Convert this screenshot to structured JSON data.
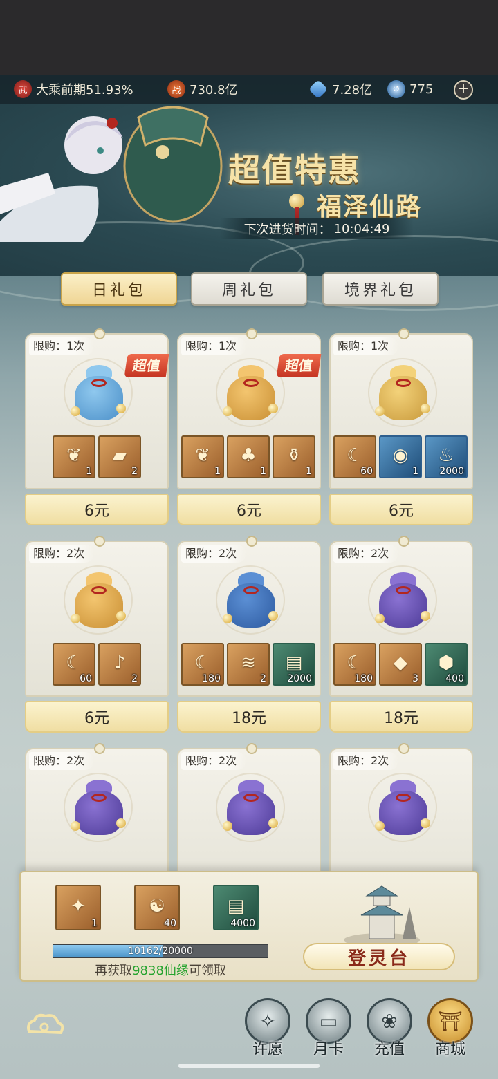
{
  "resources": {
    "realm": "大乘前期51.93%",
    "realm_icon": "武",
    "power": "730.8亿",
    "power_icon": "战",
    "spirit_stones": "7.28亿",
    "jade": "775",
    "plus": "+"
  },
  "banner": {
    "title": "超值特惠",
    "subtitle": "福泽仙路",
    "restock_label": "下次进货时间：",
    "restock_time": "10:04:49"
  },
  "tabs": [
    {
      "label": "日礼包",
      "active": true
    },
    {
      "label": "周礼包",
      "active": false
    },
    {
      "label": "境界礼包",
      "active": false
    }
  ],
  "packs": [
    {
      "limit": "限购：1次",
      "badge": "超值",
      "price": "6元",
      "items": [
        {
          "icon": "gift-bag-icon",
          "qty": "1"
        },
        {
          "icon": "card-icon",
          "qty": "2"
        }
      ]
    },
    {
      "limit": "限购：1次",
      "badge": "超值",
      "price": "6元",
      "items": [
        {
          "icon": "gift-bag-icon",
          "qty": "1"
        },
        {
          "icon": "gourd-icon",
          "qty": "1"
        },
        {
          "icon": "potion-icon",
          "qty": "1"
        }
      ]
    },
    {
      "limit": "限购：1次",
      "badge": "",
      "price": "6元",
      "items": [
        {
          "icon": "crescent-icon",
          "qty": "60"
        },
        {
          "icon": "orb-icon",
          "qty": "1"
        },
        {
          "icon": "flame-icon",
          "qty": "2000"
        }
      ]
    },
    {
      "limit": "限购：2次",
      "badge": "",
      "price": "6元",
      "items": [
        {
          "icon": "crescent-icon",
          "qty": "60"
        },
        {
          "icon": "bell-icon",
          "qty": "2"
        }
      ]
    },
    {
      "limit": "限购：2次",
      "badge": "",
      "price": "18元",
      "items": [
        {
          "icon": "crescent-icon",
          "qty": "180"
        },
        {
          "icon": "talisman-icon",
          "qty": "2"
        },
        {
          "icon": "scroll-icon",
          "qty": "2000"
        }
      ]
    },
    {
      "limit": "限购：2次",
      "badge": "",
      "price": "18元",
      "items": [
        {
          "icon": "crescent-icon",
          "qty": "180"
        },
        {
          "icon": "crystal-icon",
          "qty": "3"
        },
        {
          "icon": "ore-icon",
          "qty": "400"
        }
      ]
    },
    {
      "limit": "限购：2次",
      "badge": "",
      "price": "",
      "items": []
    },
    {
      "limit": "限购：2次",
      "badge": "",
      "price": "",
      "items": []
    },
    {
      "limit": "限购：2次",
      "badge": "",
      "price": "",
      "items": []
    }
  ],
  "milestone": {
    "rewards": [
      {
        "icon": "feather-icon",
        "qty": "1"
      },
      {
        "icon": "yin-yang-icon",
        "qty": "40"
      },
      {
        "icon": "scroll-icon",
        "qty": "4000"
      }
    ],
    "progress_text": "10162/20000",
    "progress_fraction": 0.5081,
    "hint_prefix": "再获取",
    "hint_amount": "9838仙缘",
    "hint_suffix": "可领取",
    "button": "登灵台"
  },
  "nav": [
    {
      "label": "许愿",
      "icon": "star-icon",
      "active": false
    },
    {
      "label": "月卡",
      "icon": "card-icon",
      "active": false
    },
    {
      "label": "充值",
      "icon": "pouch-icon",
      "active": false
    },
    {
      "label": "商城",
      "icon": "shop-icon",
      "active": true
    }
  ],
  "colors": {
    "accent_gold": "#f7e3a8",
    "badge_red": "#c43422",
    "hint_green": "#25a32e",
    "progress_blue": "#4a94c9"
  }
}
